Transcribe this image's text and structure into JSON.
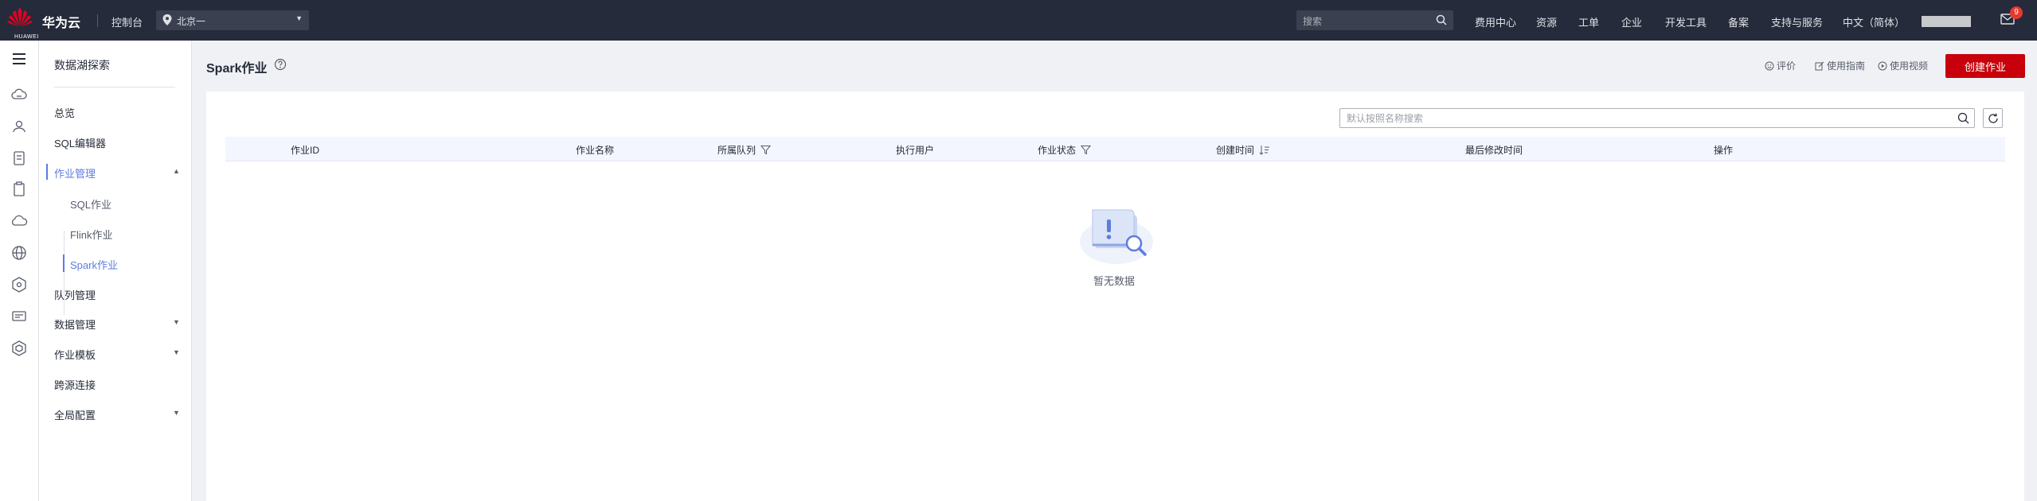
{
  "topbar": {
    "logo_text": "HUAWEI",
    "brand": "华为云",
    "console": "控制台",
    "region": "北京一",
    "search_placeholder": "搜索",
    "nav": [
      "费用中心",
      "资源",
      "工单",
      "企业",
      "开发工具",
      "备案",
      "支持与服务",
      "中文（简体）"
    ],
    "notification_count": "9"
  },
  "rail": {
    "icons": [
      "cloud-icon",
      "people-icon",
      "document-icon",
      "clipboard-icon",
      "cloud-outline-icon",
      "globe-icon",
      "cube-icon",
      "monitor-icon",
      "hexagon-icon"
    ]
  },
  "sidebar": {
    "title": "数据湖探索",
    "items": {
      "overview": "总览",
      "sql_editor": "SQL编辑器",
      "job_mgmt": "作业管理",
      "sql_jobs": "SQL作业",
      "flink_jobs": "Flink作业",
      "spark_jobs": "Spark作业",
      "queue_mgmt": "队列管理",
      "data_mgmt": "数据管理",
      "job_templates": "作业模板",
      "cross_source": "跨源连接",
      "global_config": "全局配置"
    }
  },
  "header": {
    "title": "Spark作业",
    "rate": "评价",
    "guide": "使用指南",
    "video": "使用视频",
    "create": "创建作业"
  },
  "table": {
    "search_placeholder": "默认按照名称搜索",
    "columns": {
      "job_id": "作业ID",
      "job_name": "作业名称",
      "queue": "所属队列",
      "user": "执行用户",
      "status": "作业状态",
      "created": "创建时间",
      "modified": "最后修改时间",
      "ops": "操作"
    },
    "empty_text": "暂无数据"
  },
  "colors": {
    "topbar": "#252b3a",
    "accent": "#5e7ce0",
    "primary_button": "#c7000b",
    "header_row": "#f3f6fe"
  }
}
